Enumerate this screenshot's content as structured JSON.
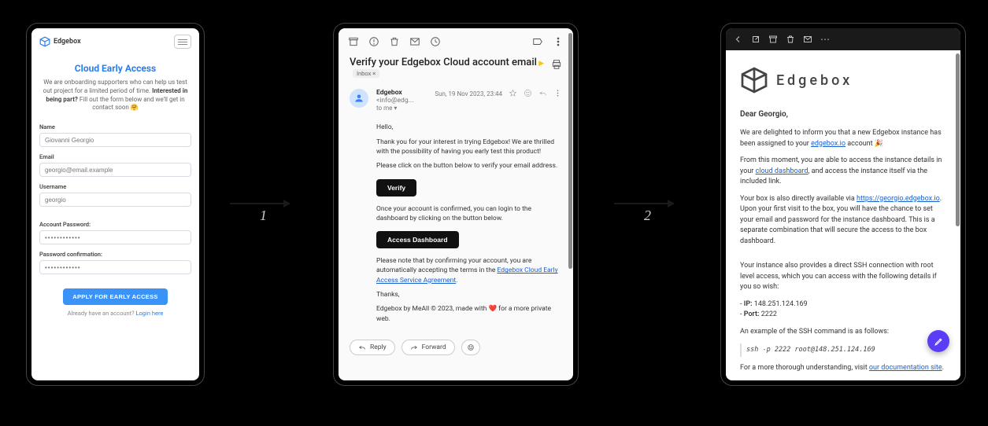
{
  "arrows": {
    "first": "1",
    "second": "2"
  },
  "panel1": {
    "brand": "Edgebox",
    "title": "Cloud Early Access",
    "intro_pre": "We are onboarding supporters who can help us test out project for a limited period of time. ",
    "intro_bold": "Interested in being part?",
    "intro_post": " Fill out the form below and we'll get in contact soon 🤗",
    "labels": {
      "name": "Name",
      "email": "Email",
      "username": "Username",
      "password": "Account Password:",
      "password_confirm": "Password confirmation:"
    },
    "values": {
      "name": "Giovanni Georgio",
      "email": "georgio@email.example",
      "username": "georgio",
      "password": "••••••••••••",
      "password_confirm": "••••••••••••"
    },
    "submit": "APPLY FOR EARLY ACCESS",
    "login_pre": "Already have an account? ",
    "login_link": "Login here"
  },
  "panel2": {
    "subject": "Verify your Edgebox Cloud account email",
    "inbox_label": "Inbox",
    "sender_name": "Edgebox",
    "sender_addr": "<info@edg...",
    "to_me": "to me",
    "date": "Sun, 19 Nov 2023, 23:44",
    "body": {
      "hello": "Hello,",
      "p1": "Thank you for your interest in trying Edgebox! We are thrilled with the possibility of having you early test this product!",
      "p2": "Please click on the button below to verify your email address.",
      "verify_btn": "Verify",
      "p3": "Once your account is confirmed, you can login to the dashboard by clicking on the button below.",
      "dashboard_btn": "Access Dashboard",
      "p4_pre": "Please note that by confirming your account, you are automatically accepting the terms in the ",
      "p4_link": "Edgebox Cloud Early Access Service Agreement",
      "thanks": "Thanks,",
      "sig": "Edgebox by MeAll © 2023, made with ❤️ for a more private web."
    },
    "actions": {
      "reply": "Reply",
      "forward": "Forward"
    }
  },
  "panel3": {
    "brand": "Edgebox",
    "greeting": "Dear Georgio,",
    "p1_pre": "We are delighted to inform you that a new Edgebox instance has been assigned to your ",
    "p1_link": "edgebox.io",
    "p1_post": " account 🎉",
    "p2_pre": "From this moment, you are able to access the instance details in your ",
    "p2_link": "cloud dashboard",
    "p2_post": ", and access the instance itself via the included link.",
    "p3_pre": "Your box is also directly available via ",
    "p3_link": "https://georgio.edgebox.io",
    "p3_post": ". Upon your first visit to the box, you will have the chance to set your email and password for the instance dashboard. This is a separate combination that will secure the access to the box dashboard.",
    "p4": "Your instance also provides a direct SSH connection with root level access, which you can access with the following details if you so wish:",
    "ip_label": "IP:",
    "ip_value": "148.251.124.169",
    "port_label": "Port:",
    "port_value": "2222",
    "p5": "An example of the SSH command is as follows:",
    "ssh": "ssh -p 2222 root@148.251.124.169",
    "p6_pre": "For a more thorough understanding, visit ",
    "p6_link": "our documentation site",
    "p6_post": "."
  }
}
